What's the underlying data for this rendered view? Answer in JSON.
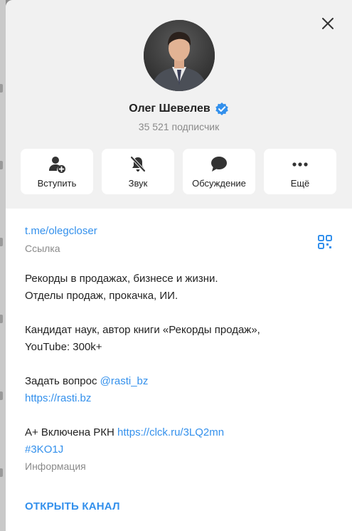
{
  "channel": {
    "name": "Олег Шевелев",
    "subscribers": "35 521 подписчик"
  },
  "actions": [
    {
      "label": "Вступить",
      "icon": "add-user-icon"
    },
    {
      "label": "Звук",
      "icon": "bell-off-icon"
    },
    {
      "label": "Обсуждение",
      "icon": "chat-bubble-icon"
    },
    {
      "label": "Ещё",
      "icon": "more-dots-icon"
    }
  ],
  "info": {
    "link": "t.me/olegcloser",
    "link_caption": "Ссылка",
    "desc_line1": "Рекорды в продажах, бизнесе и жизни.",
    "desc_line2": "Отделы продаж, прокачка, ИИ.",
    "desc_line3": "Кандидат наук, автор книги «Рекорды продаж»,",
    "desc_line4": "YouTube: 300k+",
    "ask_text": "Задать вопрос ",
    "ask_handle": "@rasti_bz",
    "site_url": "https://rasti.bz",
    "rkn_text": "A+ Включена РКН ",
    "rkn_link": "https://clck.ru/3LQ2mn",
    "hashtag": "#3KO1J",
    "info_caption": "Информация"
  },
  "open_channel": "ОТКРЫТЬ КАНАЛ",
  "colors": {
    "accent": "#3390ec",
    "header_bg": "#f1f1f1",
    "caption": "#8a8a8a"
  }
}
